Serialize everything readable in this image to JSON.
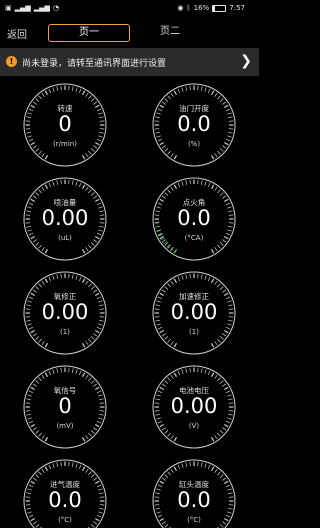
{
  "status": {
    "left_icons": [
      "carrier-icon",
      "signal-icon",
      "signal-icon",
      "wifi-icon"
    ],
    "battery_text": "16%",
    "battery_level": 0.16,
    "time": "7:57"
  },
  "nav": {
    "back": "返回",
    "tabs": [
      {
        "label": "页一",
        "active": true
      },
      {
        "label": "页二",
        "active": false
      }
    ]
  },
  "banner": {
    "icon": "!",
    "text": "尚未登录，请转至通讯界面进行设置"
  },
  "gauges": [
    {
      "label": "转速",
      "value": "0",
      "unit": "(r/min)",
      "indicator": false
    },
    {
      "label": "油门开度",
      "value": "0.0",
      "unit": "(%)",
      "indicator": false
    },
    {
      "label": "喷油量",
      "value": "0.00",
      "unit": "(uL)",
      "indicator": false
    },
    {
      "label": "点火角",
      "value": "0.0",
      "unit": "(°CA)",
      "indicator": true
    },
    {
      "label": "氧修正",
      "value": "0.00",
      "unit": "(1)",
      "indicator": false
    },
    {
      "label": "加速修正",
      "value": "0.00",
      "unit": "(1)",
      "indicator": false
    },
    {
      "label": "氧信号",
      "value": "0",
      "unit": "(mV)",
      "indicator": false
    },
    {
      "label": "电池电压",
      "value": "0.00",
      "unit": "(V)",
      "indicator": false
    },
    {
      "label": "进气温度",
      "value": "0.0",
      "unit": "(°C)",
      "indicator": false
    },
    {
      "label": "缸头温度",
      "value": "0.0",
      "unit": "(°C)",
      "indicator": false
    }
  ],
  "colors": {
    "accent": "#f2a23a",
    "banner_bg": "#2b2b2b",
    "gauge_ring": "#cfcfcf",
    "indicator": "#2ecc40"
  }
}
